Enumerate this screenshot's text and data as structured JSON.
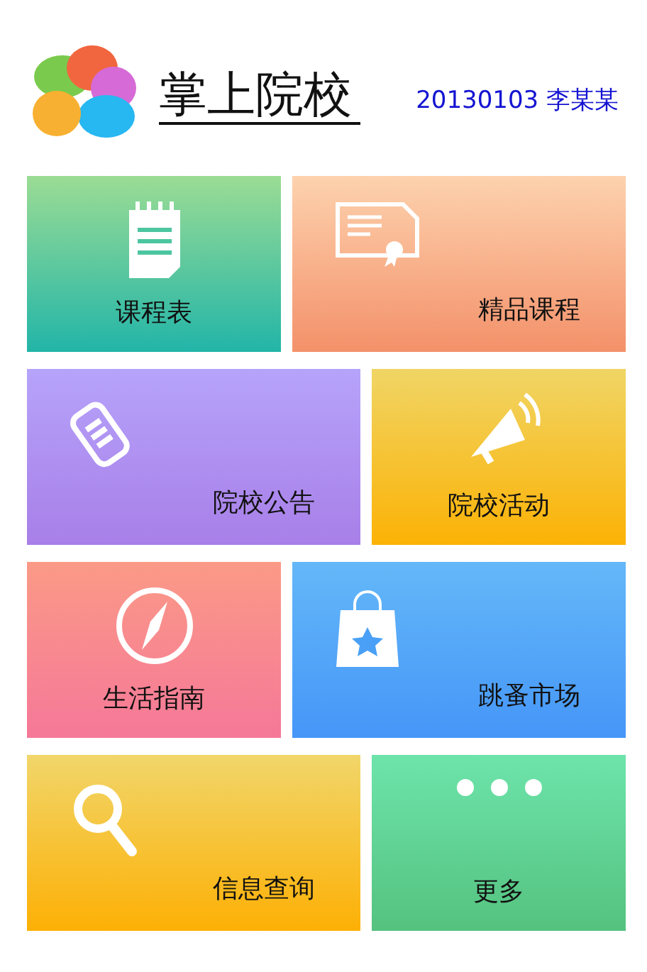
{
  "header": {
    "title": "掌上院校",
    "user": "20130103 李某某"
  },
  "rows": [
    [
      {
        "label": "课程表",
        "color": "#9bdc94"
      },
      {
        "label": "精品课程",
        "color": "#fdd2ae"
      }
    ],
    [
      {
        "label": "院校公告",
        "color": "#b6a3fa"
      },
      {
        "label": "院校活动",
        "color": "#f0d565"
      }
    ],
    [
      {
        "label": "生活指南",
        "color": "#fb9a87"
      },
      {
        "label": "跳蚤市场",
        "color": "#64b8f8"
      }
    ],
    [
      {
        "label": "信息查询",
        "color": "#f1d66a"
      },
      {
        "label": "更多",
        "color": "#6de4ab"
      }
    ]
  ]
}
